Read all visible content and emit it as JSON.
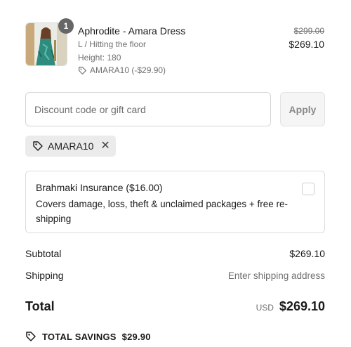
{
  "line_item": {
    "quantity": "1",
    "name": "Aphrodite - Amara Dress",
    "variant": "L / Hitting the floor",
    "height": "Height: 180",
    "discount": "AMARA10 (-$29.90)",
    "price_original": "$299.00",
    "price_final": "$269.10",
    "image_icon": "dress-product-photo"
  },
  "discount_form": {
    "placeholder": "Discount code or gift card",
    "apply_label": "Apply"
  },
  "applied_code": {
    "label": "AMARA10",
    "remove_symbol": "✕",
    "icon": "tag-icon"
  },
  "insurance": {
    "title": "Brahmaki Insurance ($16.00)",
    "description": "Covers damage, loss, theft & unclaimed packages + free re-shipping",
    "checked": false
  },
  "summary": {
    "subtotal_label": "Subtotal",
    "subtotal_value": "$269.10",
    "shipping_label": "Shipping",
    "shipping_value": "Enter shipping address",
    "total_label": "Total",
    "currency": "USD",
    "total_value": "$269.10",
    "savings_label": "TOTAL SAVINGS",
    "savings_value": "$29.90"
  },
  "colors": {
    "text": "#1a1a1a",
    "muted": "#707070",
    "border": "#dcdcdc",
    "badge": "#666666",
    "tag_bg": "#ebebeb"
  }
}
